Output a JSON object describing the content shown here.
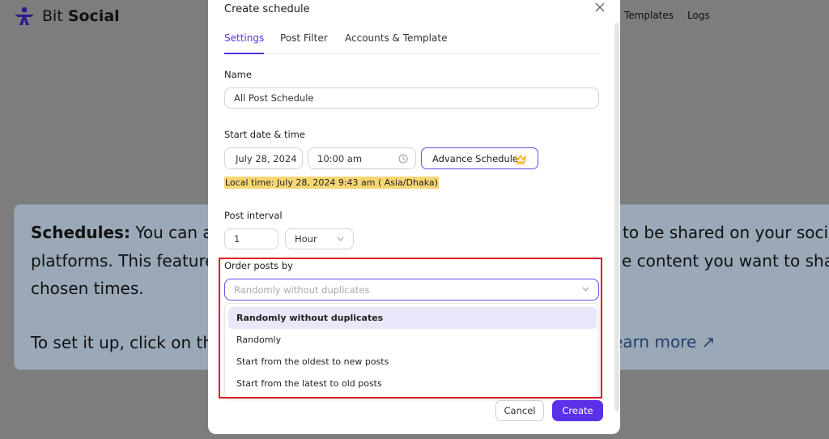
{
  "app": {
    "brand_light": "Bit",
    "brand_bold": "Social",
    "nav": [
      "Templates",
      "Logs"
    ]
  },
  "info": {
    "line1_bold": "Schedules:",
    "line1_a": "You can au",
    "line1_b": "to be shared on your socia",
    "line2_a": "platforms. This feature",
    "line2_b": "e content you want to share",
    "line3": "chosen times.",
    "line4": "To set it up, click on the",
    "learn_more": "earn more ↗"
  },
  "modal": {
    "title": "Create schedule",
    "tabs": [
      "Settings",
      "Post Filter",
      "Accounts & Template"
    ],
    "active_tab": "Settings",
    "name_label": "Name",
    "name_value": "All Post Schedule",
    "start_label": "Start date & time",
    "date_value": "July 28, 2024",
    "time_value": "10:00 am",
    "advance_label": "Advance Schedule",
    "local_time": "Local time: July 28, 2024 9:43 am ( Asia/Dhaka)",
    "interval_label": "Post interval",
    "interval_value": "1",
    "interval_unit": "Hour",
    "order_label": "Order posts by",
    "order_placeholder": "Randomly without duplicates",
    "order_options": [
      "Randomly without duplicates",
      "Randomly",
      "Start from the oldest to new posts",
      "Start from the latest to old posts"
    ],
    "cancel_label": "Cancel",
    "create_label": "Create"
  },
  "colors": {
    "accent": "#5a31e8",
    "highlight_border": "#e3121b",
    "local_time_bg": "#f7d774",
    "crown": "#f0a500"
  }
}
